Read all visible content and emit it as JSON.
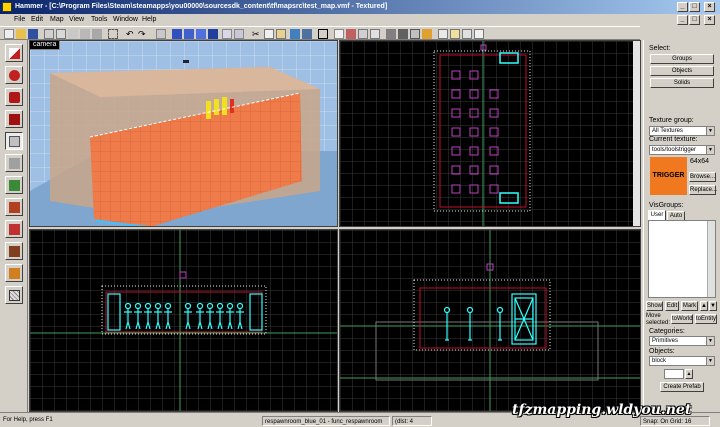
{
  "window": {
    "app_name": "Hammer",
    "title": "Hammer - [C:\\Program Files\\Steam\\steamapps\\you00000\\sourcesdk_content\\tf\\mapsrc\\test_map.vmf - Textured]",
    "controls": [
      "_",
      "□",
      "×"
    ]
  },
  "menu": {
    "items": [
      "File",
      "Edit",
      "Map",
      "View",
      "Tools",
      "Window",
      "Help"
    ]
  },
  "viewports": {
    "camera_label": "camera",
    "top_label": "",
    "front_label": "",
    "side_label": ""
  },
  "right_panel": {
    "select_label": "Select:",
    "groups_button": "Groups",
    "objects_button": "Objects",
    "solids_button": "Solids",
    "texture_group_label": "Texture group:",
    "texture_group_value": "All Textures",
    "current_texture_label": "Current texture:",
    "current_texture_value": "tools/toolstrigger",
    "texture_preview_text": "TRIGGER",
    "texture_size": "64x64",
    "browse_button": "Browse...",
    "replace_button": "Replace...",
    "visgroups_label": "VisGroups:",
    "tab_user": "User",
    "tab_auto": "Auto",
    "show_button": "Show",
    "edit_button": "Edit",
    "mark_button": "Mark",
    "move_selected_label": "Move selected:",
    "to_world_button": "toWorld",
    "to_entity_button": "toEntity",
    "categories_label": "Categories:",
    "categories_value": "Primitives",
    "objects_label": "Objects:",
    "objects_value": "block",
    "faces_value": "",
    "create_prefab_button": "Create Prefab"
  },
  "status": {
    "help_text": "For Help, press F1",
    "selection_text": "respawnroom_blue_01 - func_respawnroom",
    "dimensions_text": "(dlst: 4",
    "snap_text": "Snap: On Grid: 16"
  },
  "watermark": "tfzmapping.wldyou.net",
  "colors": {
    "title_start": "#0a246a",
    "title_end": "#a6caf0",
    "viewport_bg": "#000000",
    "grid": "#3a3a3a",
    "grid_major": "#5a5a5a",
    "brush_outline": "#e8e8e8",
    "selection_red": "#c0102a",
    "entity_magenta": "#c040c0",
    "cyan_model": "#33ffff",
    "axis_green": "#40a060",
    "trigger_orange": "#f0781e"
  }
}
